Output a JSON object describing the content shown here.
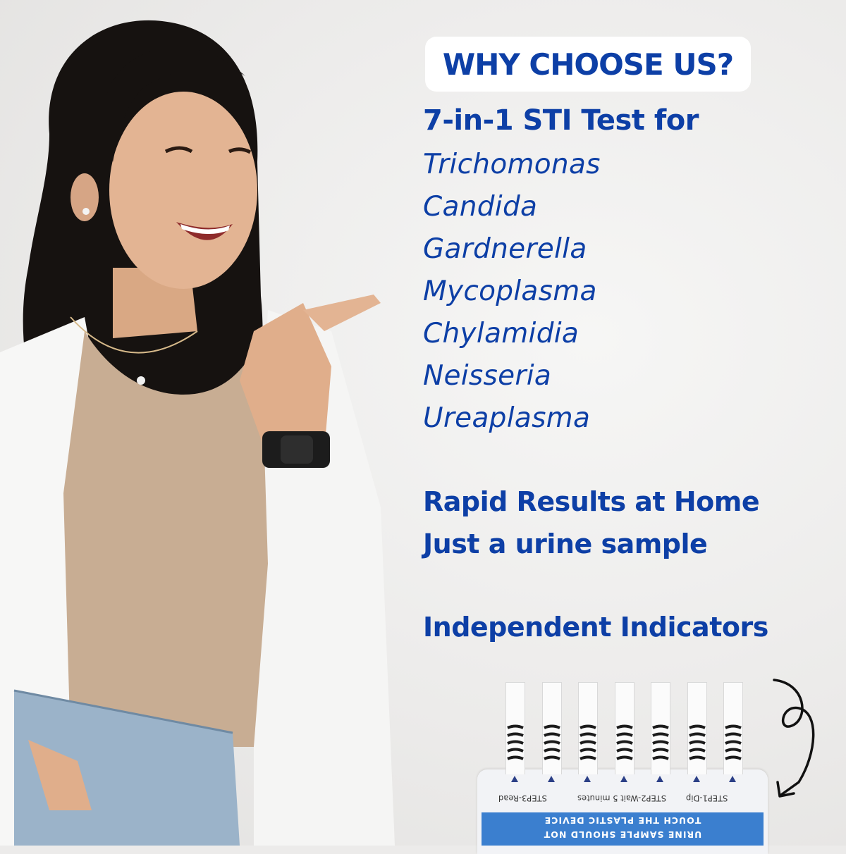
{
  "headline": "WHY CHOOSE US?",
  "subhead": "7-in-1 STI Test for",
  "organisms": [
    "Trichomonas",
    "Candida",
    "Gardnerella",
    "Mycoplasma",
    "Chylamidia",
    "Neisseria",
    "Ureaplasma"
  ],
  "features": [
    "Rapid Results at Home",
    "Just a urine sample",
    "Independent Indicators"
  ],
  "device": {
    "step_labels": [
      "STEP3-Read",
      "STEP2-Wait 5 minutes",
      "STEP1-Dip"
    ],
    "warning_line1": "TOUCH THE PLASTIC DEVICE",
    "warning_line2": "URINE SAMPLE SHOULD NOT",
    "strip_count": 7
  },
  "colors": {
    "brand_blue": "#0d3fa6",
    "band_blue": "#3b7fcf",
    "pill_bg": "#ffffff"
  },
  "icons": [
    "curly-arrow-icon"
  ]
}
